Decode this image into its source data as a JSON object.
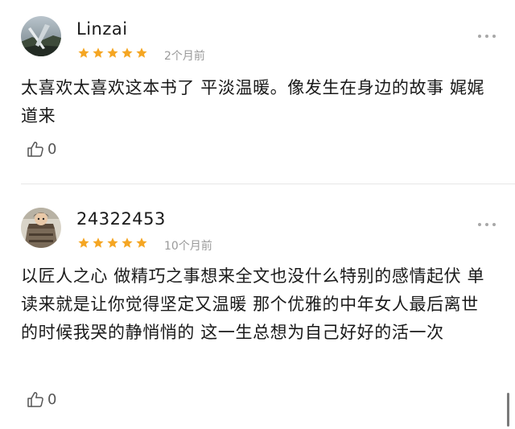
{
  "reviews": [
    {
      "username": "Linzai",
      "rating": 5,
      "time": "2个月前",
      "content": "太喜欢太喜欢这本书了 平淡温暖。像发生在身边的故事 娓娓道来",
      "likes": "0",
      "avatar_icon": "landscape-photo-avatar"
    },
    {
      "username": "24322453",
      "rating": 5,
      "time": "10个月前",
      "content": "以匠人之心 做精巧之事想来全文也没什么特别的感情起伏 单读来就是让你觉得坚定又温暖 那个优雅的中年女人最后离世的时候我哭的静悄悄的 这一生总想为自己好好的活一次",
      "likes": "0",
      "avatar_icon": "cartoon-character-avatar"
    }
  ],
  "colors": {
    "star": "#f5a623",
    "meta_text": "#9a9a9a",
    "divider": "#e6e6e6"
  }
}
